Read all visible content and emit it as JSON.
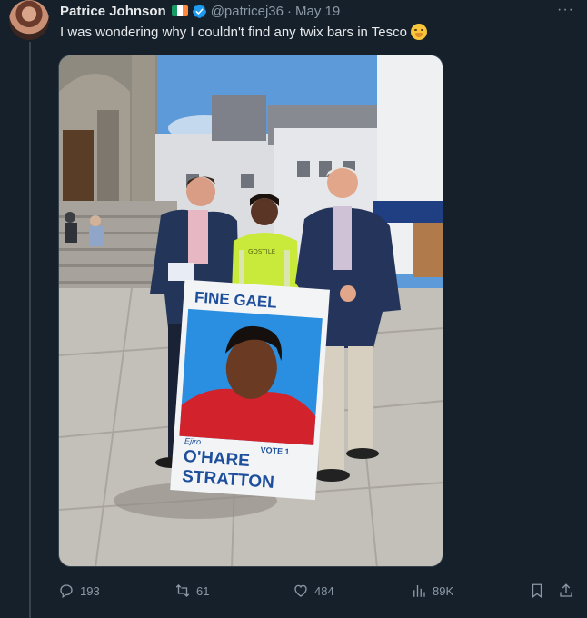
{
  "tweet": {
    "author_name": "Patrice Johnson",
    "handle": "@patricej36",
    "separator": "·",
    "date": "May 19",
    "text": "I was wondering why I couldn't find any twix bars in Tesco",
    "more_label": "···",
    "flag_colors": [
      "#169b62",
      "#ffffff",
      "#ff883e"
    ],
    "verified_color": "#1d9bf0"
  },
  "media": {
    "poster_party": "FINE GAEL",
    "poster_first_name": "Ejiro",
    "poster_surname_line1": "O'HARE",
    "poster_surname_line2": "STRATTON",
    "poster_badge": "VOTE 1",
    "vest_text": "GOSTILE"
  },
  "actions": {
    "replies": "193",
    "reposts": "61",
    "likes": "484",
    "views": "89K"
  },
  "colors": {
    "background": "#15202b",
    "text": "#e7e9ea",
    "muted": "#8b98a5",
    "poster_blue": "#1e4f9c"
  }
}
